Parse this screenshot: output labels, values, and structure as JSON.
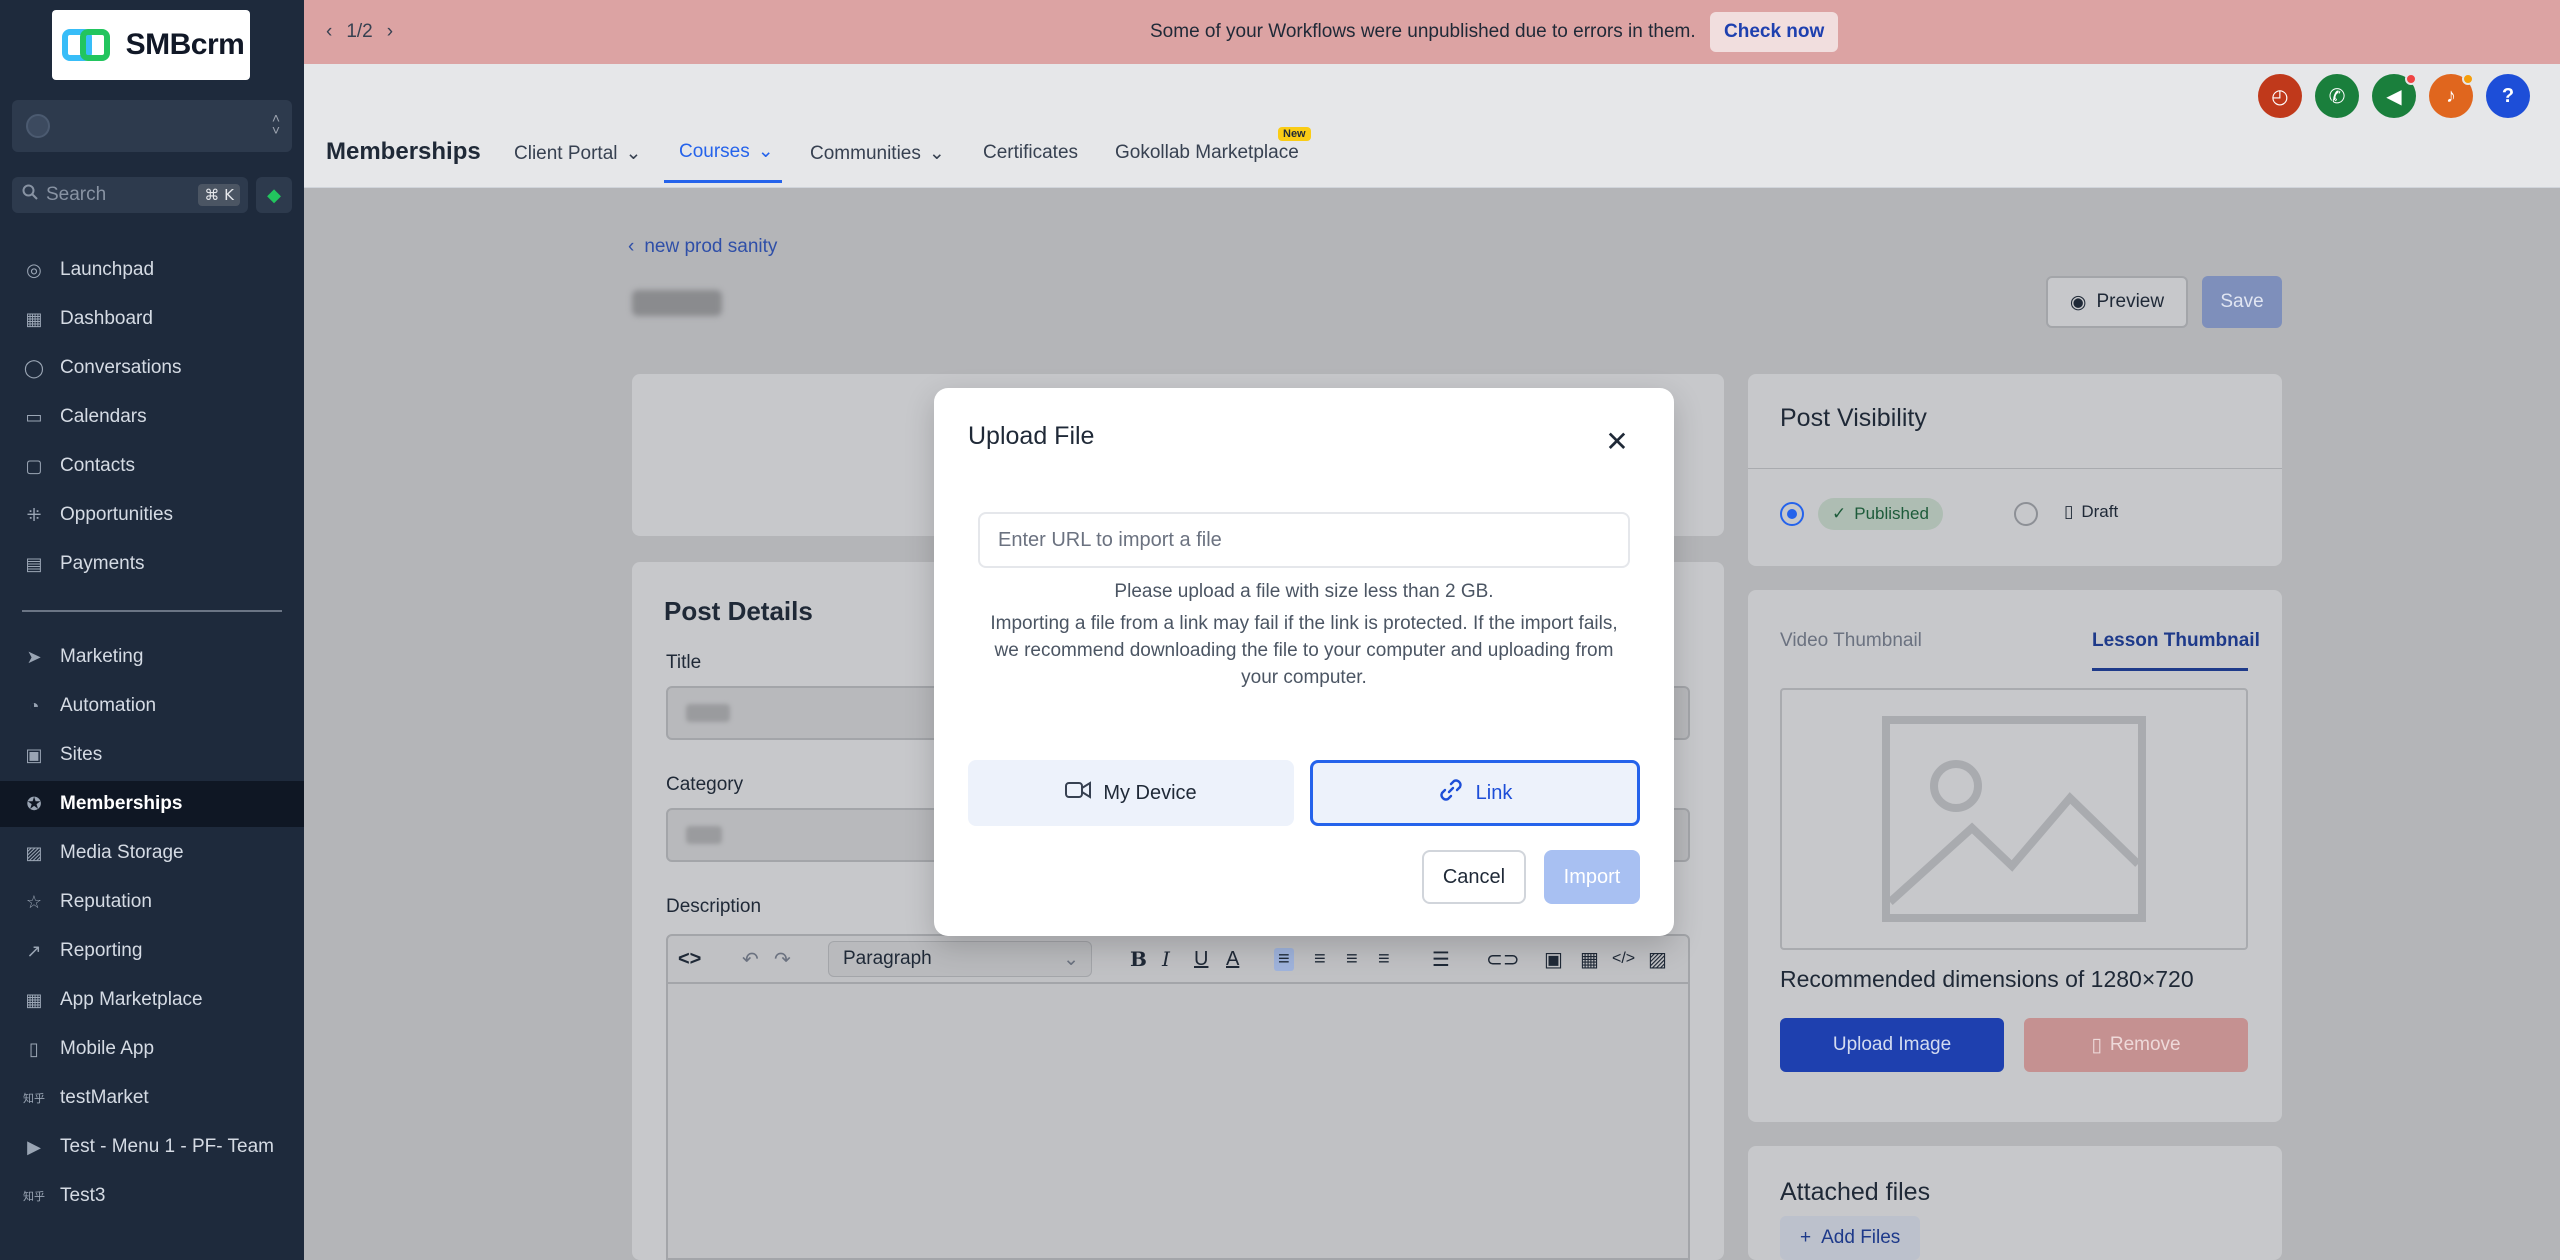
{
  "sidebar": {
    "logo_text": "SMBcrm",
    "search_placeholder": "Search",
    "search_shortcut": "⌘ K",
    "items": [
      {
        "label": "Launchpad",
        "icon": "launchpad-icon"
      },
      {
        "label": "Dashboard",
        "icon": "dashboard-icon"
      },
      {
        "label": "Conversations",
        "icon": "chat-icon"
      },
      {
        "label": "Calendars",
        "icon": "calendar-icon"
      },
      {
        "label": "Contacts",
        "icon": "contacts-icon"
      },
      {
        "label": "Opportunities",
        "icon": "opportunities-icon"
      },
      {
        "label": "Payments",
        "icon": "payments-icon"
      },
      {
        "label": "Marketing",
        "icon": "send-icon"
      },
      {
        "label": "Automation",
        "icon": "automation-icon"
      },
      {
        "label": "Sites",
        "icon": "sites-icon"
      },
      {
        "label": "Memberships",
        "icon": "award-icon"
      },
      {
        "label": "Media Storage",
        "icon": "image-icon"
      },
      {
        "label": "Reputation",
        "icon": "star-icon"
      },
      {
        "label": "Reporting",
        "icon": "trend-icon"
      },
      {
        "label": "App Marketplace",
        "icon": "grid-icon"
      },
      {
        "label": "Mobile App",
        "icon": "phone-icon"
      },
      {
        "label": "testMarket",
        "icon": "custom-menu-icon"
      },
      {
        "label": "Test - Menu 1 - PF- Team",
        "icon": "video-icon"
      },
      {
        "label": "Test3",
        "icon": "custom-menu-icon"
      }
    ]
  },
  "banner": {
    "pager": "1/2",
    "message": "Some of your Workflows were unpublished due to errors in them.",
    "action": "Check now"
  },
  "header": {
    "title": "Memberships",
    "tabs": [
      {
        "label": "Client Portal",
        "has_dropdown": true
      },
      {
        "label": "Courses",
        "has_dropdown": true,
        "active": true
      },
      {
        "label": "Communities",
        "has_dropdown": true
      },
      {
        "label": "Certificates",
        "has_dropdown": false
      },
      {
        "label": "Gokollab Marketplace",
        "has_dropdown": false,
        "badge": "New"
      }
    ],
    "icon_buttons": [
      {
        "name": "speedometer-icon",
        "color": "#c0391b"
      },
      {
        "name": "phone-icon",
        "color": "#1a7f3c"
      },
      {
        "name": "megaphone-icon",
        "color": "#1a7f3c"
      },
      {
        "name": "bell-icon",
        "color": "#e0661e"
      },
      {
        "name": "help-icon",
        "color": "#1d4ed8"
      }
    ]
  },
  "page": {
    "back_link": "new prod sanity",
    "preview_label": "Preview",
    "save_label": "Save",
    "post_details_heading": "Post Details",
    "title_label": "Title",
    "category_label": "Category",
    "description_label": "Description",
    "paragraph_select": "Paragraph",
    "post_visibility_heading": "Post Visibility",
    "published_label": "Published",
    "draft_label": "Draft",
    "video_thumbnail_tab": "Video Thumbnail",
    "lesson_thumbnail_tab": "Lesson Thumbnail",
    "dims_text": "Recommended dimensions of 1280×720",
    "upload_image_label": "Upload Image",
    "remove_label": "Remove",
    "attached_files_heading": "Attached files",
    "add_files_label": "Add Files"
  },
  "modal": {
    "title": "Upload File",
    "url_placeholder": "Enter URL to import a file",
    "size_hint": "Please upload a file with size less than 2 GB.",
    "import_hint": "Importing a file from a link may fail if the link is protected. If the import fails, we recommend downloading the file to your computer and uploading from your computer.",
    "device_label": "My Device",
    "link_label": "Link",
    "cancel_label": "Cancel",
    "import_label": "Import",
    "selected_source": "Link"
  },
  "colors": {
    "sidebar_bg": "#1e2a3c",
    "accent": "#2563eb",
    "banner_bg": "#dca3a3"
  }
}
